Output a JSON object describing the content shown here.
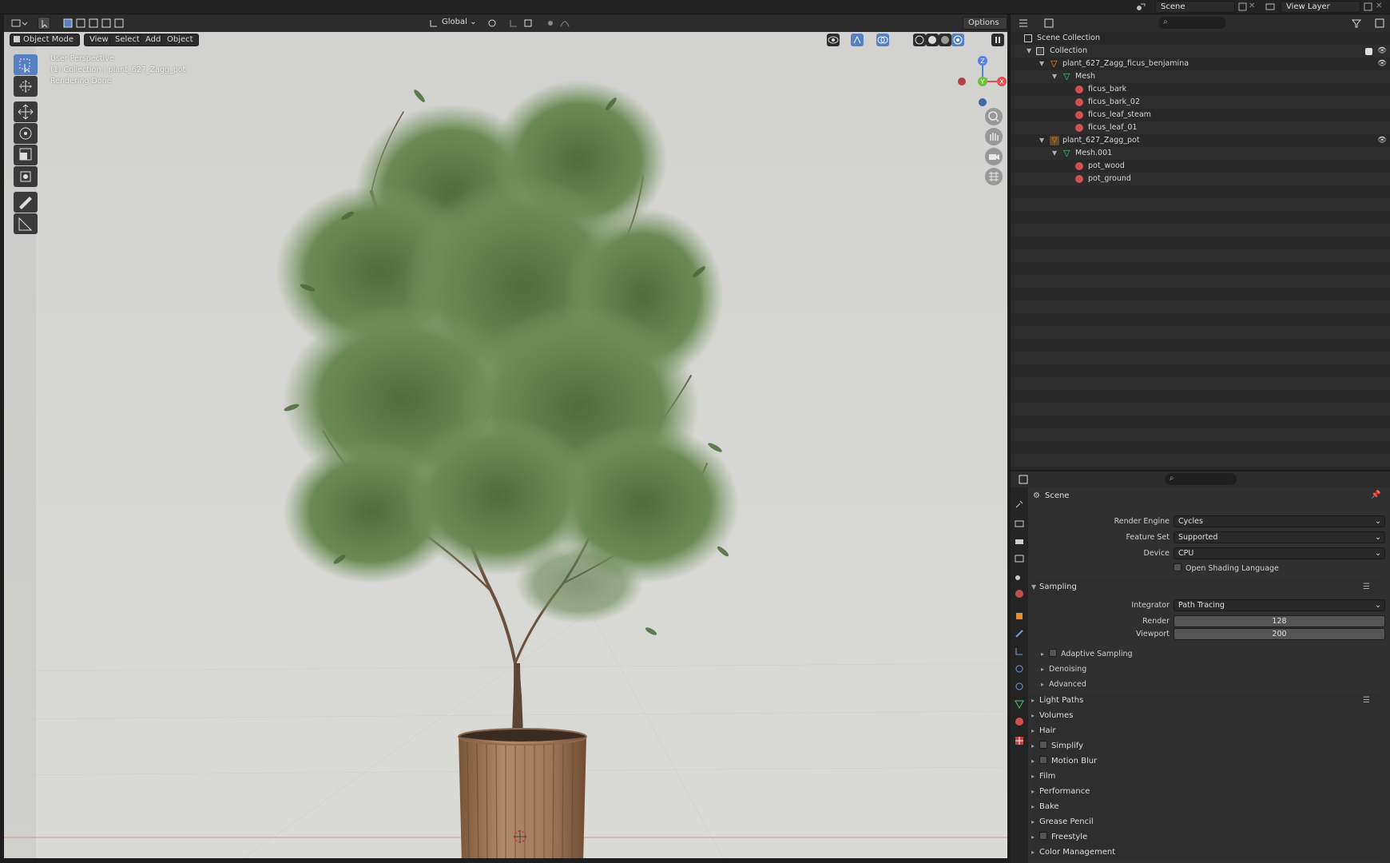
{
  "topbar": {
    "scene_label": "Scene",
    "view_layer_label": "View Layer"
  },
  "viewport_header": {
    "transform_orientation": "Global",
    "options_label": "Options",
    "mode_label": "Object Mode",
    "menus": [
      "View",
      "Select",
      "Add",
      "Object"
    ]
  },
  "viewport_overlay": {
    "line1": "User Perspective",
    "line2": "(1) Collection | plant_627_Zagg_pot",
    "line3": "Rendering Done"
  },
  "gizmo": {
    "z": "Z",
    "y": "Y",
    "x": "X"
  },
  "outliner": {
    "search_placeholder": "",
    "rows": [
      {
        "label": "Scene Collection"
      },
      {
        "label": "Collection"
      },
      {
        "label": "plant_627_Zagg_ficus_benjamina"
      },
      {
        "label": "Mesh"
      },
      {
        "label": "ficus_bark"
      },
      {
        "label": "ficus_bark_02"
      },
      {
        "label": "ficus_leaf_steam"
      },
      {
        "label": "ficus_leaf_01"
      },
      {
        "label": "plant_627_Zagg_pot"
      },
      {
        "label": "Mesh.001"
      },
      {
        "label": "pot_wood"
      },
      {
        "label": "pot_ground"
      }
    ]
  },
  "properties": {
    "context": "Scene",
    "render_engine_label": "Render Engine",
    "render_engine": "Cycles",
    "feature_set_label": "Feature Set",
    "feature_set": "Supported",
    "device_label": "Device",
    "device": "CPU",
    "osl_label": "Open Shading Language",
    "sampling_label": "Sampling",
    "integrator_label": "Integrator",
    "integrator": "Path Tracing",
    "render_label": "Render",
    "render_samples": "128",
    "viewport_label": "Viewport",
    "viewport_samples": "200",
    "adaptive_label": "Adaptive Sampling",
    "denoising_label": "Denoising",
    "advanced_label": "Advanced",
    "panels": [
      "Light Paths",
      "Volumes",
      "Hair",
      "Simplify",
      "Motion Blur",
      "Film",
      "Performance",
      "Bake",
      "Grease Pencil",
      "Freestyle",
      "Color Management"
    ]
  }
}
